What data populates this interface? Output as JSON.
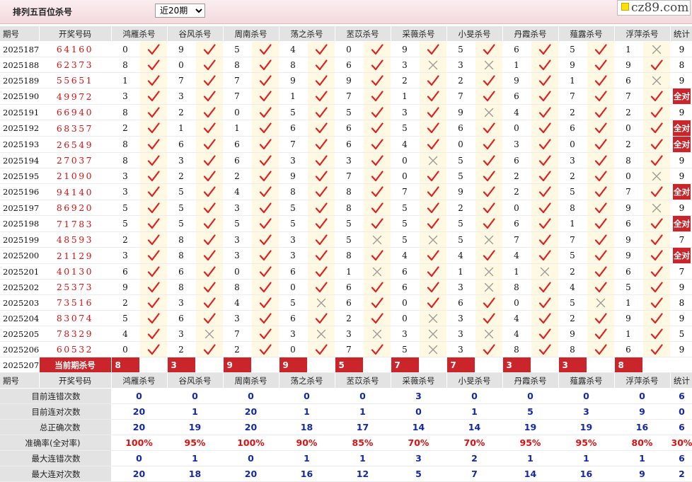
{
  "header": {
    "title": "排列五百位杀号",
    "period_select": "近20期",
    "logo_text": "cz89.com"
  },
  "columns": {
    "period": "期号",
    "winning": "开奖号码",
    "experts": [
      "鸿雁杀号",
      "谷风杀号",
      "周南杀号",
      "荡之杀号",
      "苤苡杀号",
      "采薇杀号",
      "小旻杀号",
      "丹霞杀号",
      "薤露杀号",
      "浮萍杀号"
    ],
    "count": "统计"
  },
  "rows": [
    {
      "period": "2025187",
      "number": "64160",
      "kills": [
        0,
        9,
        5,
        4,
        0,
        9,
        5,
        6,
        5,
        1
      ],
      "hits": [
        1,
        1,
        1,
        1,
        1,
        1,
        1,
        1,
        1,
        0
      ],
      "count": "9"
    },
    {
      "period": "2025188",
      "number": "62373",
      "kills": [
        8,
        0,
        8,
        8,
        6,
        3,
        3,
        1,
        9,
        9
      ],
      "hits": [
        1,
        1,
        1,
        1,
        1,
        0,
        0,
        1,
        1,
        1
      ],
      "count": "8"
    },
    {
      "period": "2025189",
      "number": "55651",
      "kills": [
        1,
        7,
        7,
        9,
        9,
        2,
        2,
        9,
        1,
        6
      ],
      "hits": [
        1,
        1,
        1,
        1,
        1,
        1,
        1,
        1,
        1,
        0
      ],
      "count": "9"
    },
    {
      "period": "2025190",
      "number": "49972",
      "kills": [
        3,
        3,
        7,
        1,
        7,
        1,
        7,
        6,
        7,
        7
      ],
      "hits": [
        1,
        1,
        1,
        1,
        1,
        1,
        1,
        1,
        1,
        1
      ],
      "count": "全对"
    },
    {
      "period": "2025191",
      "number": "66940",
      "kills": [
        8,
        2,
        0,
        5,
        5,
        3,
        9,
        4,
        2,
        2
      ],
      "hits": [
        1,
        1,
        1,
        1,
        1,
        1,
        0,
        1,
        1,
        1
      ],
      "count": "9"
    },
    {
      "period": "2025192",
      "number": "68357",
      "kills": [
        2,
        1,
        1,
        6,
        6,
        5,
        6,
        0,
        6,
        0
      ],
      "hits": [
        1,
        1,
        1,
        1,
        1,
        1,
        1,
        1,
        1,
        1
      ],
      "count": "全对"
    },
    {
      "period": "2025193",
      "number": "26549",
      "kills": [
        8,
        6,
        6,
        7,
        6,
        4,
        0,
        3,
        0,
        2
      ],
      "hits": [
        1,
        1,
        1,
        1,
        1,
        1,
        1,
        1,
        1,
        1
      ],
      "count": "全对"
    },
    {
      "period": "2025194",
      "number": "27037",
      "kills": [
        8,
        3,
        6,
        3,
        3,
        0,
        5,
        6,
        3,
        8
      ],
      "hits": [
        1,
        1,
        1,
        1,
        1,
        0,
        1,
        1,
        1,
        1
      ],
      "count": "9"
    },
    {
      "period": "2025195",
      "number": "21090",
      "kills": [
        3,
        2,
        2,
        9,
        7,
        0,
        5,
        2,
        2,
        0
      ],
      "hits": [
        1,
        1,
        1,
        1,
        1,
        1,
        1,
        1,
        1,
        0
      ],
      "count": "9"
    },
    {
      "period": "2025196",
      "number": "94140",
      "kills": [
        3,
        5,
        4,
        8,
        8,
        7,
        9,
        2,
        5,
        7
      ],
      "hits": [
        1,
        1,
        1,
        1,
        1,
        1,
        1,
        1,
        1,
        1
      ],
      "count": "全对"
    },
    {
      "period": "2025197",
      "number": "86920",
      "kills": [
        5,
        5,
        3,
        5,
        8,
        5,
        2,
        0,
        8,
        9
      ],
      "hits": [
        1,
        1,
        1,
        1,
        1,
        1,
        1,
        1,
        1,
        0
      ],
      "count": "9"
    },
    {
      "period": "2025198",
      "number": "71783",
      "kills": [
        5,
        5,
        5,
        5,
        5,
        5,
        5,
        6,
        1,
        6
      ],
      "hits": [
        1,
        1,
        1,
        1,
        1,
        1,
        1,
        1,
        1,
        1
      ],
      "count": "全对"
    },
    {
      "period": "2025199",
      "number": "48593",
      "kills": [
        2,
        8,
        3,
        3,
        5,
        5,
        5,
        7,
        7,
        9
      ],
      "hits": [
        1,
        1,
        1,
        1,
        0,
        0,
        0,
        1,
        1,
        1
      ],
      "count": "7"
    },
    {
      "period": "2025200",
      "number": "21129",
      "kills": [
        3,
        8,
        3,
        3,
        8,
        4,
        4,
        4,
        5,
        9
      ],
      "hits": [
        1,
        1,
        1,
        1,
        1,
        1,
        1,
        1,
        1,
        1
      ],
      "count": "全对"
    },
    {
      "period": "2025201",
      "number": "40130",
      "kills": [
        6,
        6,
        0,
        6,
        1,
        6,
        1,
        1,
        2,
        6
      ],
      "hits": [
        1,
        1,
        1,
        1,
        0,
        1,
        0,
        0,
        1,
        1
      ],
      "count": "7"
    },
    {
      "period": "2025202",
      "number": "25373",
      "kills": [
        9,
        8,
        8,
        0,
        6,
        6,
        3,
        8,
        4,
        5
      ],
      "hits": [
        1,
        1,
        1,
        1,
        1,
        1,
        0,
        1,
        1,
        1
      ],
      "count": "9"
    },
    {
      "period": "2025203",
      "number": "73516",
      "kills": [
        2,
        3,
        4,
        5,
        6,
        0,
        6,
        0,
        5,
        1
      ],
      "hits": [
        1,
        1,
        1,
        0,
        1,
        1,
        1,
        1,
        0,
        1
      ],
      "count": "8"
    },
    {
      "period": "2025204",
      "number": "83074",
      "kills": [
        5,
        6,
        3,
        6,
        2,
        0,
        3,
        4,
        2,
        9
      ],
      "hits": [
        1,
        1,
        1,
        1,
        1,
        0,
        1,
        1,
        1,
        1
      ],
      "count": "9"
    },
    {
      "period": "2025205",
      "number": "78329",
      "kills": [
        4,
        3,
        7,
        3,
        3,
        3,
        3,
        4,
        9,
        1
      ],
      "hits": [
        1,
        0,
        1,
        0,
        0,
        0,
        0,
        1,
        1,
        1
      ],
      "count": "5"
    },
    {
      "period": "2025206",
      "number": "60532",
      "kills": [
        0,
        2,
        2,
        0,
        7,
        5,
        3,
        8,
        8,
        6
      ],
      "hits": [
        1,
        1,
        1,
        1,
        1,
        0,
        1,
        1,
        1,
        1
      ],
      "count": "9"
    }
  ],
  "current": {
    "period": "2025207",
    "label": "当前期杀号",
    "kills": [
      "8",
      "3",
      "9",
      "9",
      "5",
      "7",
      "7",
      "3",
      "3",
      "8"
    ]
  },
  "stats": [
    {
      "label": "目前连错次数",
      "values": [
        "0",
        "0",
        "0",
        "0",
        "0",
        "3",
        "0",
        "0",
        "0",
        "0"
      ],
      "total": "6"
    },
    {
      "label": "目前连对次数",
      "values": [
        "20",
        "1",
        "20",
        "1",
        "1",
        "0",
        "1",
        "5",
        "3",
        "9"
      ],
      "total": "0"
    },
    {
      "label": "总正确次数",
      "values": [
        "20",
        "19",
        "20",
        "18",
        "17",
        "14",
        "14",
        "19",
        "19",
        "16"
      ],
      "total": "6"
    },
    {
      "label": "准确率(全对率)",
      "values": [
        "100%",
        "95%",
        "100%",
        "90%",
        "85%",
        "70%",
        "70%",
        "95%",
        "95%",
        "80%"
      ],
      "total": "30%"
    },
    {
      "label": "最大连错次数",
      "values": [
        "0",
        "1",
        "0",
        "1",
        "1",
        "3",
        "2",
        "1",
        "1",
        "1"
      ],
      "total": "6"
    },
    {
      "label": "最大连对次数",
      "values": [
        "20",
        "18",
        "20",
        "16",
        "12",
        "5",
        "7",
        "14",
        "16",
        "9"
      ],
      "total": "2"
    }
  ],
  "icons": {
    "hit": "check-mark-icon",
    "miss": "x-mark-icon"
  },
  "colors": {
    "hit_mark": "#e02020",
    "miss_mark": "#9a9a9a",
    "accent": "#c9252b",
    "header_bg": "#e3e3e3",
    "mark_cell_bg": "#fff9e3",
    "stat_blue": "#1228a8",
    "stat_red": "#dd1111"
  }
}
